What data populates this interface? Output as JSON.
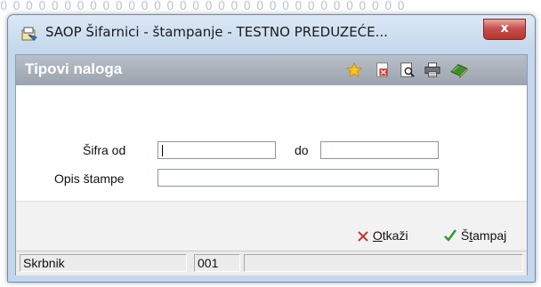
{
  "window": {
    "title": "SAOP Šifarnici - štampanje - TESTNO PREDUZEĆE...",
    "close_glyph": "x"
  },
  "header": {
    "title": "Tipovi naloga"
  },
  "toolbar": {
    "icons": [
      "star-icon",
      "pdf-export-icon",
      "print-preview-icon",
      "printer-icon",
      "book-icon"
    ]
  },
  "form": {
    "sifra_od_label": "Šifra od",
    "sifra_od_value": "",
    "do_label": "do",
    "do_value": "",
    "opis_label": "Opis štampe",
    "opis_value": ""
  },
  "buttons": {
    "cancel_label_mnemonic": "O",
    "cancel_label_rest": "tkaži",
    "print_label_first": "Š",
    "print_label_mnemonic": "t",
    "print_label_rest": "ampaj"
  },
  "status": {
    "user": "Skrbnik",
    "code": "001",
    "extra": ""
  },
  "colors": {
    "header_bg": "#a6adb7",
    "title_bar": "#c4d7ec",
    "close_red": "#c75050",
    "cancel_x": "#c0392b",
    "print_check": "#2e9a2e"
  }
}
